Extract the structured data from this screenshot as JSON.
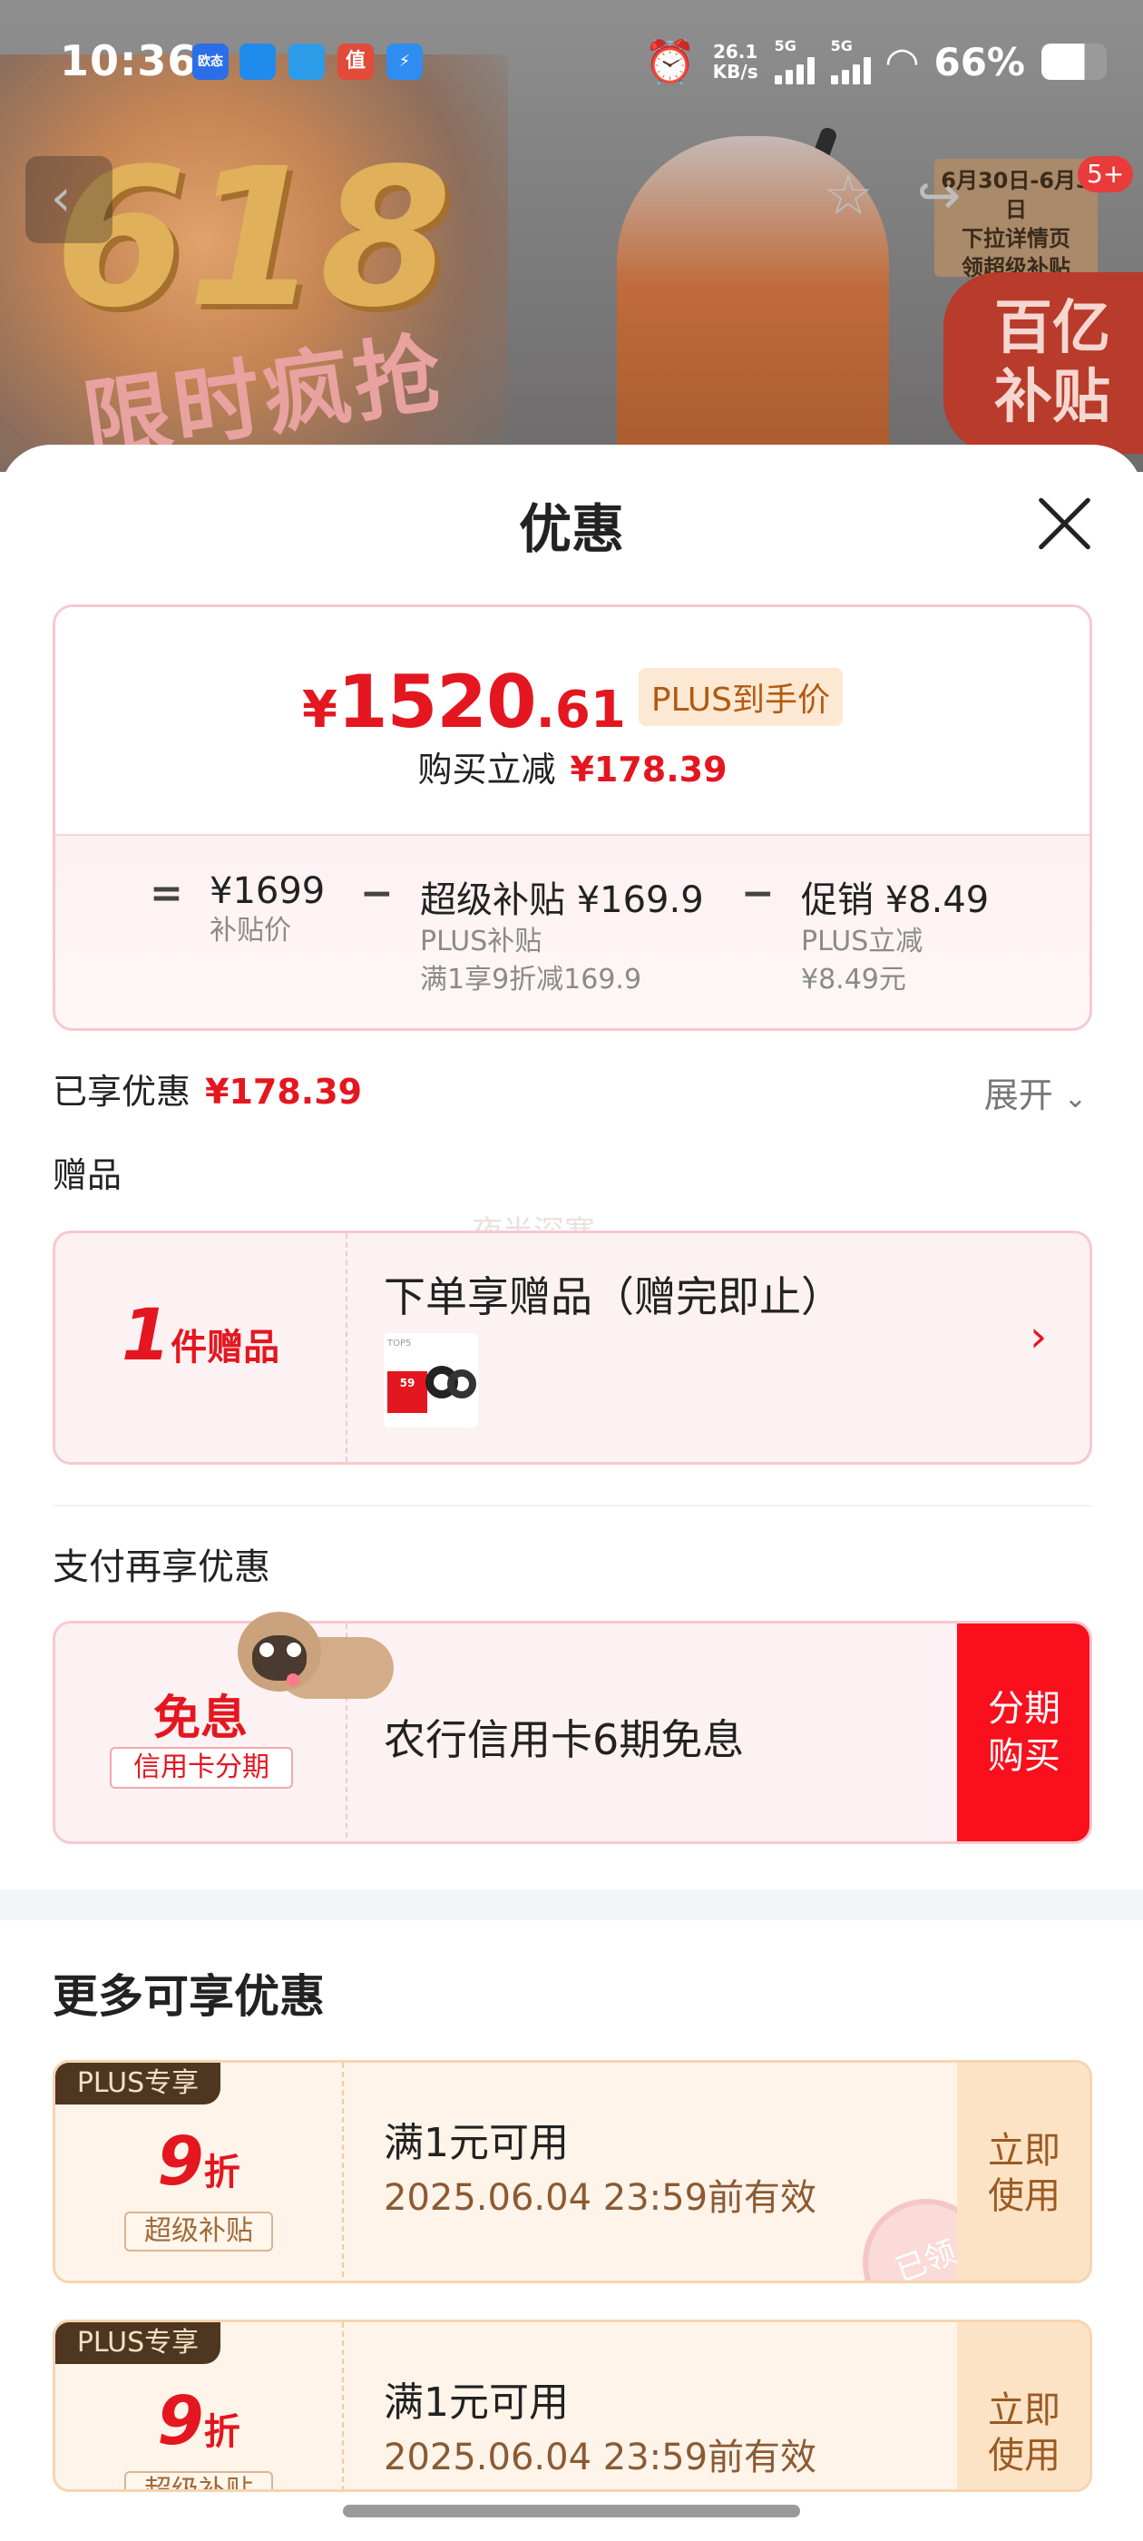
{
  "status_bar": {
    "time": "10:36",
    "app_icons": [
      "欧态",
      "",
      "",
      "值",
      ""
    ],
    "net_speed_value": "26.1",
    "net_speed_unit": "KB/s",
    "signal_1": "5G",
    "signal_2": "5G",
    "battery": "66%"
  },
  "background": {
    "big_number": "618",
    "slogan": "限时疯抢",
    "date_note": "6月30日-6月3日",
    "pull_line1": "下拉详情页",
    "pull_line2": "领超级补贴",
    "badge_line1": "百亿",
    "badge_line2": "补贴",
    "more_count": "5+"
  },
  "sheet": {
    "title": "优惠",
    "price": {
      "currency": "¥",
      "integer": "1520",
      "decimal": ".61",
      "tag": "PLUS到手价",
      "reduce_label": "购买立减",
      "reduce_value": "¥178.39"
    },
    "breakdown": {
      "eq": "=",
      "minus": "−",
      "item1_value": "¥1699",
      "item1_label": "补贴价",
      "item2_value": "超级补贴 ¥169.9",
      "item2_label": "PLUS补贴",
      "item2_note": "满1享9折减169.9",
      "item3_value": "促销 ¥8.49",
      "item3_label": "PLUS立减",
      "item3_note": "¥8.49元"
    },
    "enjoyed_label": "已享优惠",
    "enjoyed_value": "¥178.39",
    "expand": "展开",
    "gift_label": "赠品",
    "watermark": "夜半深寒",
    "gift": {
      "count": "1",
      "count_unit": "件赠品",
      "title": "下单享赠品（赠完即止）",
      "img_text": "TOP5",
      "img_price": "59"
    },
    "pay_label": "支付再享优惠",
    "pay": {
      "free": "免息",
      "tag": "信用卡分期",
      "title": "农行信用卡6期免息",
      "btn_line1": "分期",
      "btn_line2": "购买"
    },
    "more_title": "更多可享优惠",
    "coupons": [
      {
        "tag": "PLUS专享",
        "num": "9",
        "unit": "折",
        "chip": "超级补贴",
        "cond": "满1元可用",
        "date": "2025.06.04 23:59前有效",
        "btn_line1": "立即",
        "btn_line2": "使用",
        "stamp": "已领"
      },
      {
        "tag": "PLUS专享",
        "num": "9",
        "unit": "折",
        "chip": "超级补贴",
        "cond": "满1元可用",
        "date": "2025.06.04 23:59前有效",
        "btn_line1": "立即",
        "btn_line2": "使用"
      }
    ]
  },
  "colors": {
    "accent": "#e4161f",
    "plus_dark": "#4e3621",
    "coupon_bg": "#fef4e9"
  }
}
